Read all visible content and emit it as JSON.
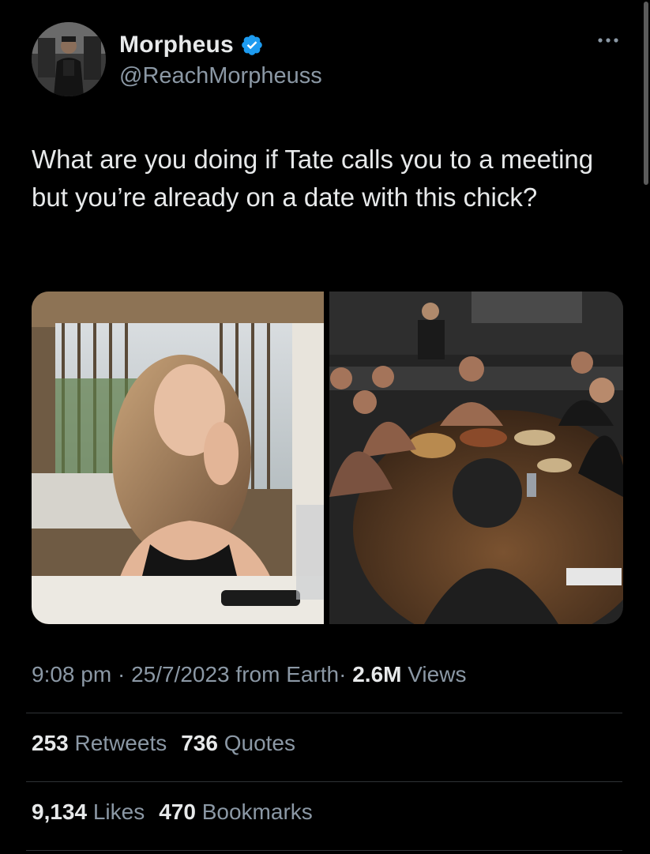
{
  "author": {
    "display_name": "Morpheus",
    "handle": "@ReachMorpheuss",
    "verified": true
  },
  "tweet": {
    "text": "What are you doing if Tate calls you to a meeting but you’re already on a date with this chick?"
  },
  "media": {
    "count": 2,
    "items": [
      "photo-woman-cafe",
      "photo-group-dinner-table"
    ]
  },
  "meta": {
    "time": "9:08 pm",
    "separator": "·",
    "date": "25/7/2023",
    "source": "from Earth",
    "views_count": "2.6M",
    "views_label": "Views"
  },
  "stats": {
    "retweets_count": "253",
    "retweets_label": "Retweets",
    "quotes_count": "736",
    "quotes_label": "Quotes",
    "likes_count": "9,134",
    "likes_label": "Likes",
    "bookmarks_count": "470",
    "bookmarks_label": "Bookmarks"
  },
  "colors": {
    "background": "#000000",
    "text": "#e7e9ea",
    "secondary": "#8b98a5",
    "verified": "#1d9bf0",
    "divider": "#2f3336"
  },
  "icons": [
    "verified-badge-icon",
    "more-options-icon"
  ]
}
